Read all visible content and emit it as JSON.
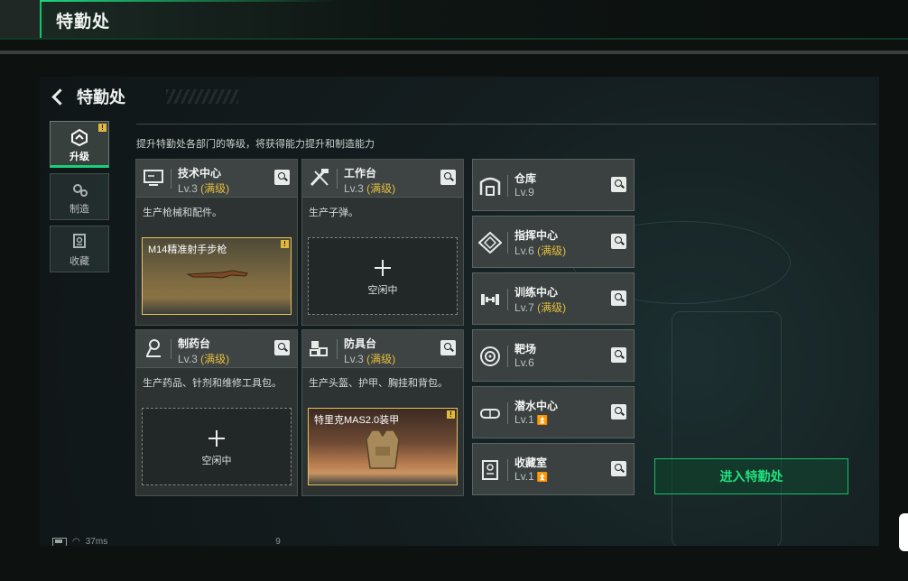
{
  "topbar": {
    "title": "特勤处"
  },
  "page": {
    "title": "特勤处",
    "subtitle": "提升特勤处各部门的等级，将获得能力提升和制造能力"
  },
  "sidenav": [
    {
      "label": "升级",
      "active": true,
      "badge": "!"
    },
    {
      "label": "制造",
      "active": false
    },
    {
      "label": "收藏",
      "active": false
    }
  ],
  "cards": [
    {
      "name": "技术中心",
      "level": "Lv.3",
      "max": "(满级)",
      "desc": "生产枪械和配件。",
      "slot": {
        "type": "item",
        "item_name": "M14精准射手步枪",
        "badge": "!"
      }
    },
    {
      "name": "工作台",
      "level": "Lv.3",
      "max": "(满级)",
      "desc": "生产子弹。",
      "slot": {
        "type": "empty",
        "label": "空闲中"
      }
    },
    {
      "name": "制药台",
      "level": "Lv.3",
      "max": "(满级)",
      "desc": "生产药品、针剂和维修工具包。",
      "slot": {
        "type": "empty",
        "label": "空闲中"
      }
    },
    {
      "name": "防具台",
      "level": "Lv.3",
      "max": "(满级)",
      "desc": "生产头盔、护甲、胸挂和背包。",
      "slot": {
        "type": "item",
        "item_name": "特里克MAS2.0装甲",
        "badge": "!"
      }
    }
  ],
  "right_cards": [
    {
      "name": "仓库",
      "level": "Lv.9",
      "max": "",
      "upgrade": false
    },
    {
      "name": "指挥中心",
      "level": "Lv.6",
      "max": "(满级)",
      "upgrade": false
    },
    {
      "name": "训练中心",
      "level": "Lv.7",
      "max": "(满级)",
      "upgrade": false
    },
    {
      "name": "靶场",
      "level": "Lv.6",
      "max": "",
      "upgrade": false
    },
    {
      "name": "潜水中心",
      "level": "Lv.1",
      "max": "",
      "upgrade": true
    },
    {
      "name": "收藏室",
      "level": "Lv.1",
      "max": "",
      "upgrade": true
    }
  ],
  "enter_button": "进入特勤处",
  "status": {
    "ping": "37ms",
    "extra": "9"
  },
  "colors": {
    "accent": "#18d07a",
    "max_level": "#e4bd3e",
    "item_border": "#e5c25a"
  }
}
